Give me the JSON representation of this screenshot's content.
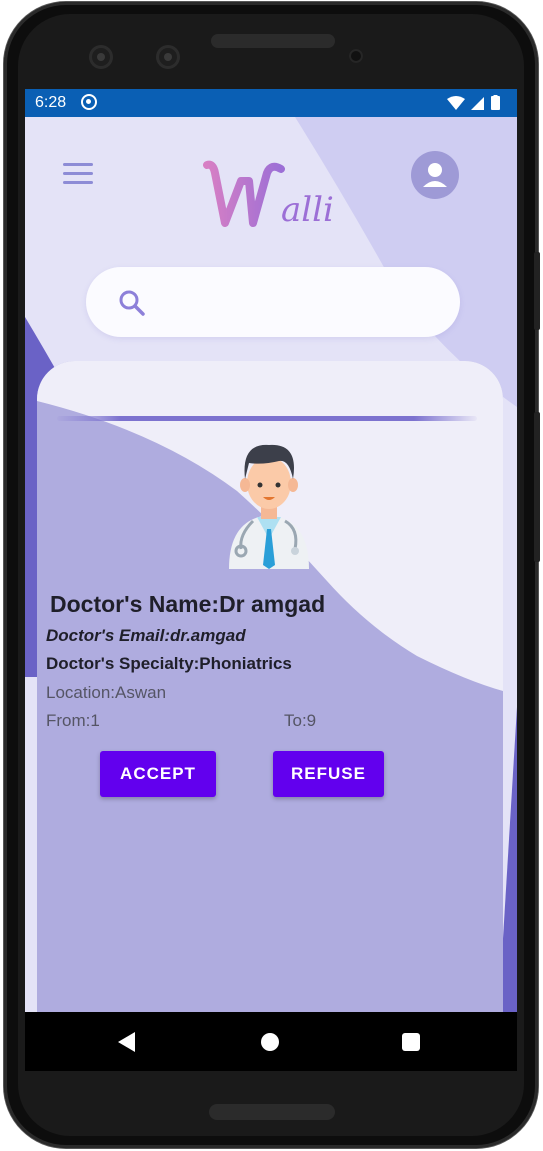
{
  "status_bar": {
    "time": "6:28",
    "sync_icon": "sync-icon",
    "icons": [
      "wifi-icon",
      "signal-icon",
      "battery-icon"
    ]
  },
  "header": {
    "menu_icon": "hamburger-menu-icon",
    "logo_text": "Walli",
    "profile_icon": "user-avatar-icon"
  },
  "search": {
    "icon": "search-icon",
    "placeholder": "",
    "value": ""
  },
  "doctor_card": {
    "image": "doctor-avatar-illustration",
    "name": "Doctor's Name:Dr amgad",
    "email": "Doctor's Email:dr.amgad",
    "specialty": "Doctor's Specialty:Phoniatrics",
    "location": "Location:Aswan",
    "from": "From:1",
    "to": "To:9",
    "accept_label": "ACCEPT",
    "refuse_label": "REFUSE"
  },
  "navigation_bar": {
    "back": "back-icon",
    "home": "home-icon",
    "recents": "recents-icon"
  },
  "colors": {
    "status_bar": "#0a5fb4",
    "primary_button": "#6200ee",
    "logo_gradient_start": "#d77fc4",
    "logo_gradient_end": "#9c6fd6",
    "card_background": "#b0acde"
  }
}
